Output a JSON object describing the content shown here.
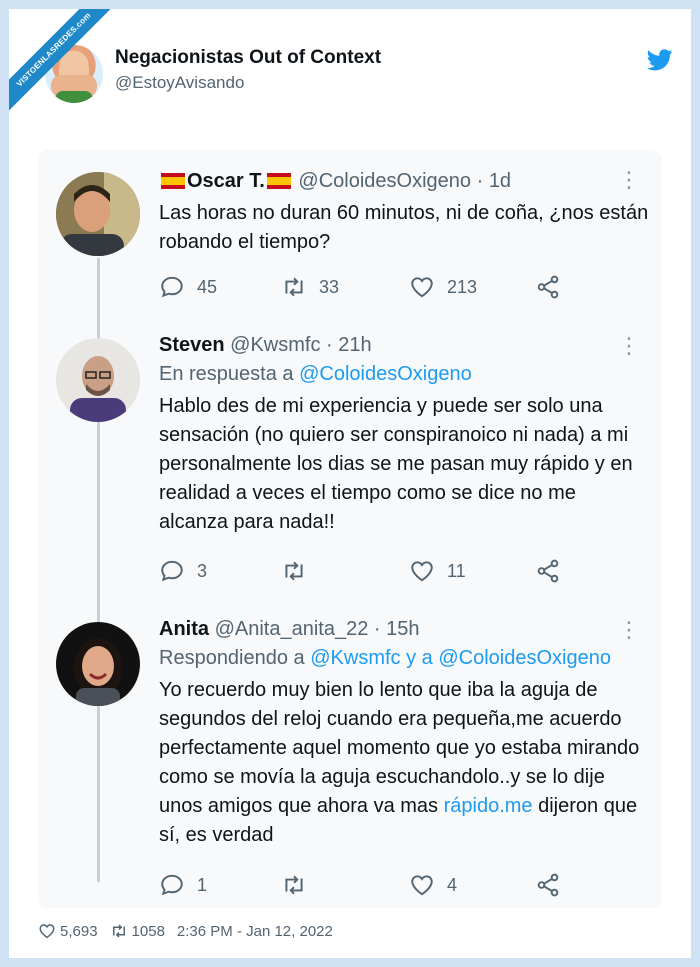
{
  "watermark": "VISTOENLASREDES.com",
  "account": {
    "name": "Negacionistas Out of Context",
    "handle": "@EstoyAvisando",
    "icon": "twitter-bird-icon",
    "brand_color": "#1d9bf0"
  },
  "thread": [
    {
      "name": "Oscar T.",
      "name_flags": "spain-flag-icon",
      "handle": "@ColoidesOxigeno",
      "time": "1d",
      "reply_prefix": "",
      "reply_targets": "",
      "text": "Las horas no duran 60 minutos, ni de coña, ¿nos están robando el tiempo?",
      "counts": {
        "replies": "45",
        "retweets": "33",
        "likes": "213"
      }
    },
    {
      "name": "Steven",
      "handle": "@Kwsmfc",
      "time": "21h",
      "reply_prefix": "En respuesta a ",
      "reply_targets": "@ColoidesOxigeno",
      "text": "Hablo des de mi experiencia y puede ser solo una sensación (no quiero ser conspiranoico ni nada) a mi personalmente los dias se me pasan muy rápido y en realidad a veces el tiempo como se dice no me alcanza para nada!!",
      "counts": {
        "replies": "3",
        "retweets": "",
        "likes": "11"
      }
    },
    {
      "name": "Anita",
      "handle": "@Anita_anita_22",
      "time": "15h",
      "reply_prefix": "Respondiendo a ",
      "reply_targets": "@Kwsmfc y a @ColoidesOxigeno",
      "text_before_link": "Yo recuerdo muy bien lo lento que iba la aguja de segundos del reloj cuando era pequeña,me acuerdo perfectamente aquel momento que yo estaba mirando como se movía la aguja escuchandolo..y se lo dije unos amigos que ahora va mas ",
      "text_link": "rápido.me",
      "text_after_link": " dijeron que sí, es verdad",
      "counts": {
        "replies": "1",
        "retweets": "",
        "likes": "4"
      }
    }
  ],
  "footer": {
    "likes": "5,693",
    "retweets": "1058",
    "timestamp": "2:36 PM - Jan 12, 2022"
  }
}
